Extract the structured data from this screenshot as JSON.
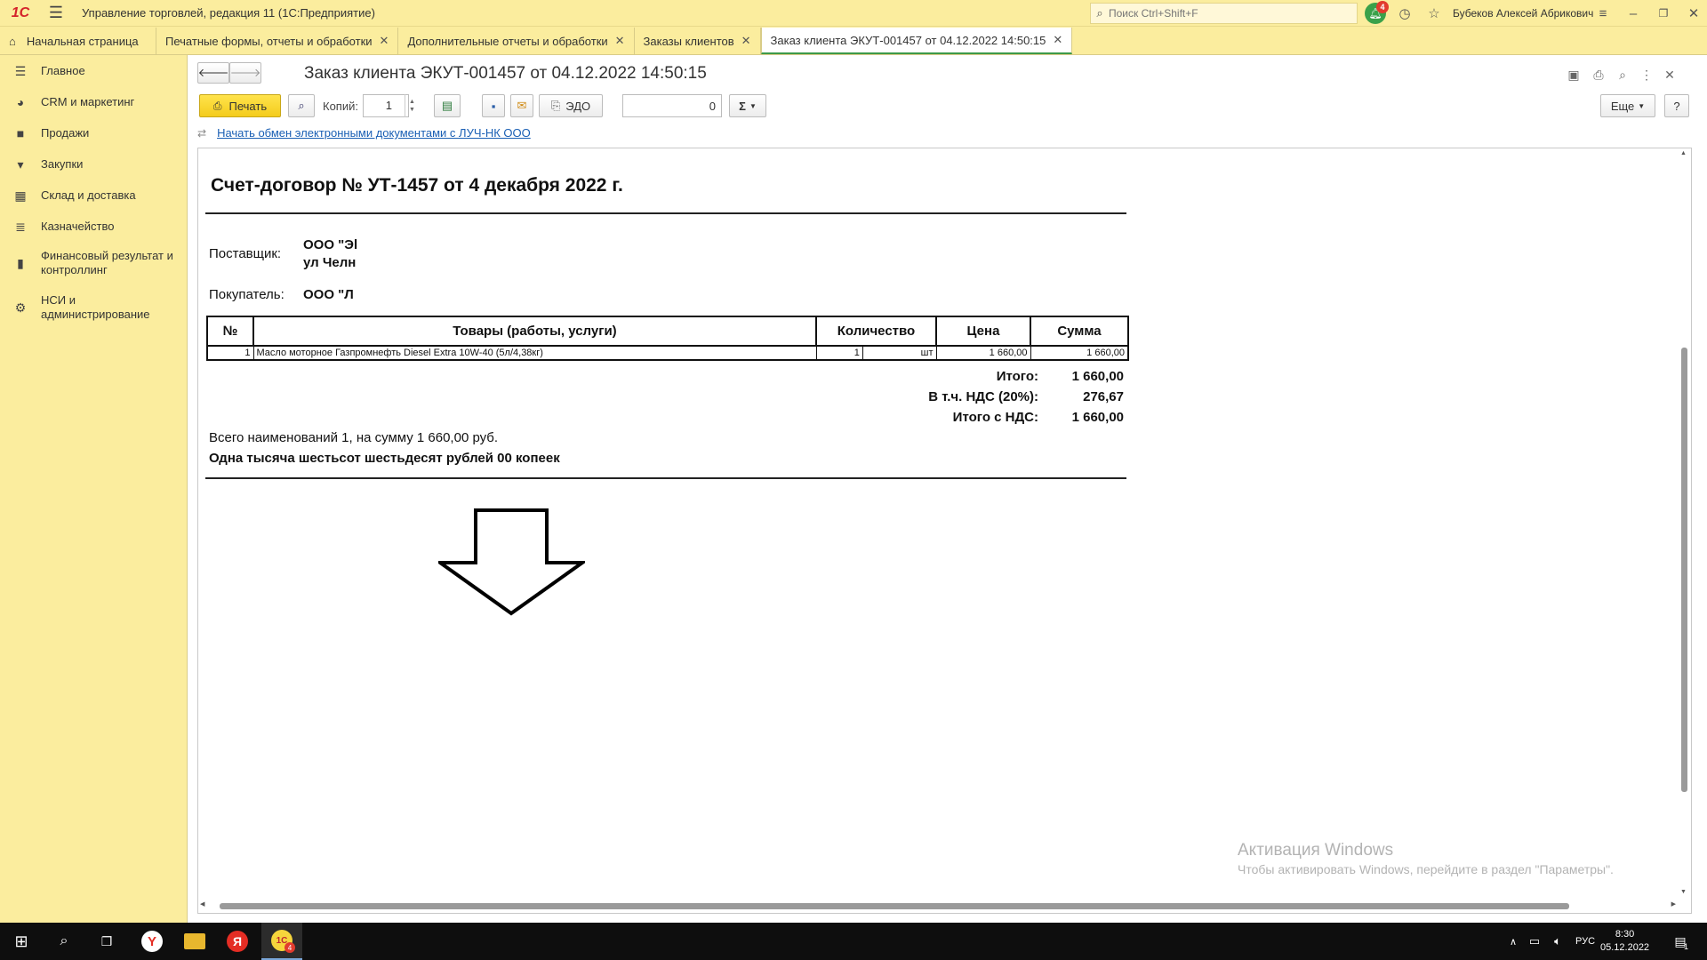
{
  "app": {
    "logo_text": "1С",
    "title": "Управление торговлей, редакция 11  (1С:Предприятие)",
    "search_placeholder": "Поиск Ctrl+Shift+F",
    "notifications_count": "4",
    "user_name": "Бубеков Алексей Абрикович"
  },
  "tabs": [
    {
      "label": "Начальная страница"
    },
    {
      "label": "Печатные формы, отчеты и обработки"
    },
    {
      "label": "Дополнительные отчеты и обработки"
    },
    {
      "label": "Заказы клиентов"
    },
    {
      "label": "Заказ клиента ЭКУТ-001457 от 04.12.2022 14:50:15"
    }
  ],
  "sidebar": {
    "items": [
      {
        "label": "Главное",
        "icon": "menu-lines-icon"
      },
      {
        "label": "CRM и маркетинг",
        "icon": "pie-chart-icon"
      },
      {
        "label": "Продажи",
        "icon": "bag-icon"
      },
      {
        "label": "Закупки",
        "icon": "cart-icon"
      },
      {
        "label": "Склад и доставка",
        "icon": "grid-icon"
      },
      {
        "label": "Казначейство",
        "icon": "coins-icon"
      },
      {
        "label": "Финансовый результат и контроллинг",
        "icon": "bar-chart-icon"
      },
      {
        "label": "НСИ и администрирование",
        "icon": "gear-icon"
      }
    ]
  },
  "form": {
    "title": "Заказ клиента ЭКУТ-001457 от 04.12.2022 14:50:15",
    "print_label": "Печать",
    "copies_label": "Копий:",
    "copies_value": "1",
    "edo_label": "ЭДО",
    "counter_value": "0",
    "sum_label": "Σ",
    "more_label": "Еще",
    "help_label": "?",
    "edo_link": "Начать обмен электронными документами с ЛУЧ-НК ООО"
  },
  "document": {
    "title": "Счет-договор № УТ-1457 от 4 декабря 2022 г.",
    "supplier_label": "Поставщик:",
    "supplier_line1": "ООО \"Эl",
    "supplier_line2": "ул Челн",
    "buyer_label": "Покупатель:",
    "buyer_value": "ООО \"Л",
    "table": {
      "headers": [
        "№",
        "Товары (работы, услуги)",
        "Количество",
        "Цена",
        "Сумма"
      ],
      "rows": [
        {
          "num": "1",
          "name": "Масло моторное Газпромнефть Diesel Extra 10W-40 (5л/4,38кг)",
          "qty": "1",
          "unit": "шт",
          "price": "1 660,00",
          "sum": "1 660,00"
        }
      ]
    },
    "totals": [
      {
        "label": "Итого:",
        "value": "1 660,00"
      },
      {
        "label": "В т.ч. НДС (20%):",
        "value": "276,67"
      },
      {
        "label": "Итого с НДС:",
        "value": "1 660,00"
      }
    ],
    "summary_line": "Всего наименований 1, на сумму 1 660,00 руб.",
    "amount_words": "Одна тысяча шестьсот шестьдесят рублей 00 копеек"
  },
  "watermark": {
    "title": "Активация Windows",
    "subtitle": "Чтобы активировать Windows, перейдите в раздел \"Параметры\"."
  },
  "taskbar": {
    "lang": "РУС",
    "time": "8:30",
    "date": "05.12.2022",
    "notif_count": "1",
    "app_badge": "4"
  }
}
